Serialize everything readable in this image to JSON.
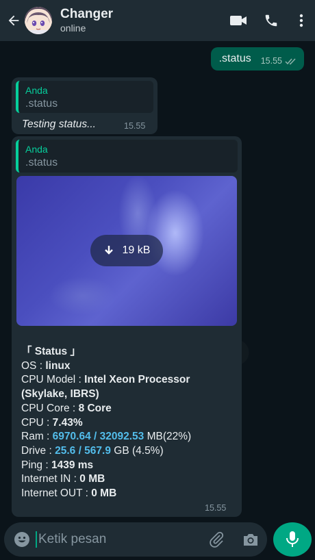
{
  "header": {
    "title": "Changer",
    "subtitle": "online",
    "icons": [
      "back-arrow-icon",
      "video-call-icon",
      "phone-icon",
      "more-vert-icon"
    ]
  },
  "outgoing": {
    "text": ".status",
    "time": "15.55",
    "ticks": "double-check-icon"
  },
  "reply1": {
    "quote_name": "Anda",
    "quote_text": ".status",
    "text": "Testing status...",
    "time": "15.55"
  },
  "reply2": {
    "quote_name": "Anda",
    "quote_text": ".status",
    "media_size": "19 kB",
    "time": "15.55",
    "status": {
      "title": "「 Status 」",
      "os_label": "OS : ",
      "os_value": "linux",
      "cpu_model_label": "CPU Model : ",
      "cpu_model_value": "Intel Xeon Processor",
      "cpu_model_value2": "(Skylake, IBRS)",
      "cpu_core_label": "CPU Core : ",
      "cpu_core_value": "8 Core",
      "cpu_label": "CPU : ",
      "cpu_value": "7.43%",
      "ram_label": "Ram : ",
      "ram_value": "6970.64 / 32092.53",
      "ram_suffix": " MB(22%)",
      "drive_label": "Drive : ",
      "drive_value": "25.6 / 567.9",
      "drive_suffix": " GB (4.5%)",
      "ping_label": "Ping : ",
      "ping_value": "1439 ms",
      "net_in_label": "Internet IN : ",
      "net_in_value": "0 MB",
      "net_out_label": "Internet OUT : ",
      "net_out_value": "0 MB"
    }
  },
  "composer": {
    "placeholder": "Ketik pesan"
  },
  "colors": {
    "accent": "#00a884",
    "outgoing_bubble": "#005c4b",
    "incoming_bubble": "#1f2c34",
    "link_blue": "#53bdeb"
  }
}
